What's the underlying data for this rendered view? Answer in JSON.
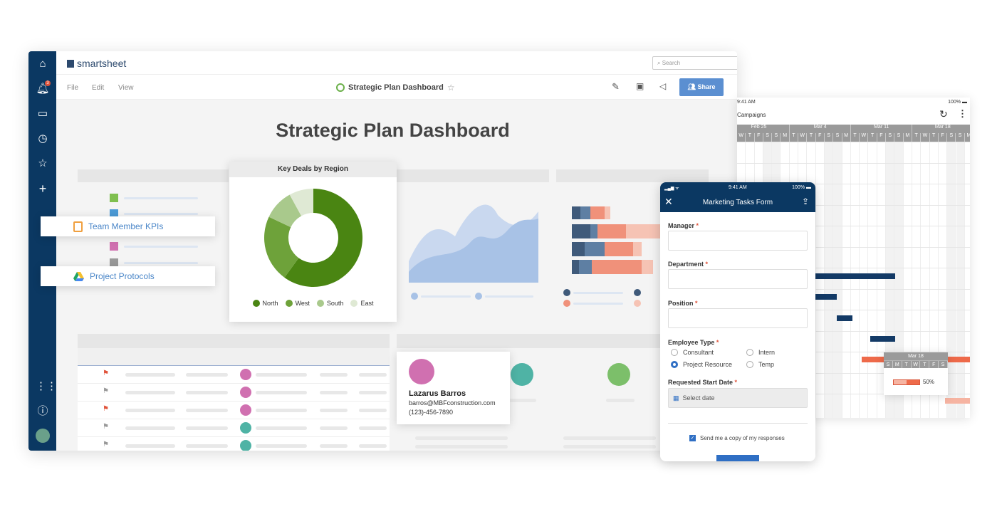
{
  "app": {
    "brand": "smartsheet",
    "search_placeholder": "Search",
    "notification_count": "3",
    "menu": [
      "File",
      "Edit",
      "View"
    ],
    "title": "Strategic Plan Dashboard",
    "share_label": "Share"
  },
  "dashboard": {
    "heading": "Strategic Plan Dashboard"
  },
  "links": [
    {
      "label": "Team Member KPIs",
      "icon": "notebook-icon"
    },
    {
      "label": "Project Protocols",
      "icon": "google-drive-icon"
    }
  ],
  "chart_data": {
    "type": "pie",
    "title": "Key Deals by Region",
    "donut": true,
    "categories": [
      "North",
      "West",
      "South",
      "East"
    ],
    "values": [
      60,
      22,
      10,
      8
    ],
    "colors": [
      "#4a8512",
      "#6ea23a",
      "#a9c98c",
      "#dfe9d4"
    ],
    "legend": "bottom"
  },
  "contact": {
    "name": "Lazarus Barros",
    "email": "barros@MBFconstruction.com",
    "phone": "(123)-456-7890"
  },
  "form": {
    "time": "9:41 AM",
    "battery": "100%",
    "title": "Marketing Tasks Form",
    "fields": [
      {
        "label": "Manager"
      },
      {
        "label": "Department"
      },
      {
        "label": "Position"
      }
    ],
    "employee_type": {
      "label": "Employee Type",
      "options": [
        "Consultant",
        "Intern",
        "Project Resource",
        "Temp"
      ],
      "selected": "Project Resource"
    },
    "start_date": {
      "label": "Requested Start Date",
      "placeholder": "Select date"
    },
    "copy_label": "Send me a copy of my responses",
    "copy_checked": true
  },
  "gantt": {
    "time": "9:41 AM",
    "battery": "100%",
    "sheet": "Campaigns",
    "weeks": [
      "Feb 25",
      "Mar 4",
      "Mar 11",
      "Mar 18",
      "M"
    ],
    "days": [
      "W",
      "T",
      "F",
      "S",
      "S",
      "M",
      "T",
      "W",
      "T",
      "F",
      "S",
      "S",
      "M",
      "T",
      "W",
      "T",
      "F",
      "S",
      "S",
      "M",
      "T",
      "W",
      "T",
      "F",
      "S",
      "S",
      "M",
      "T"
    ],
    "popup": {
      "week": "Mar 18",
      "days": [
        "S",
        "M",
        "T",
        "W",
        "T",
        "F",
        "S"
      ],
      "progress": "50%"
    }
  }
}
